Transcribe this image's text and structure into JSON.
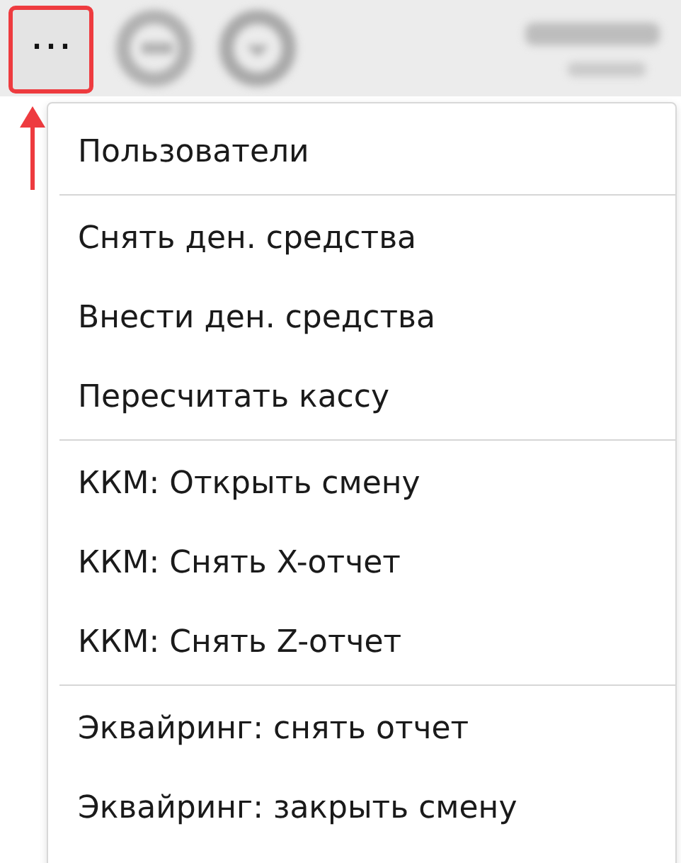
{
  "toolbar": {
    "menu_button": {
      "label": "⋯",
      "highlighted": true
    }
  },
  "menu": {
    "groups": [
      {
        "items": [
          "Пользователи"
        ]
      },
      {
        "items": [
          "Снять ден. средства",
          "Внести ден. средства",
          "Пересчитать кассу"
        ]
      },
      {
        "items": [
          "ККМ: Открыть смену",
          "ККМ: Снять X-отчет",
          "ККМ: Снять Z-отчет"
        ]
      },
      {
        "items": [
          "Эквайринг: снять отчет",
          "Эквайринг: закрыть смену"
        ]
      }
    ]
  }
}
